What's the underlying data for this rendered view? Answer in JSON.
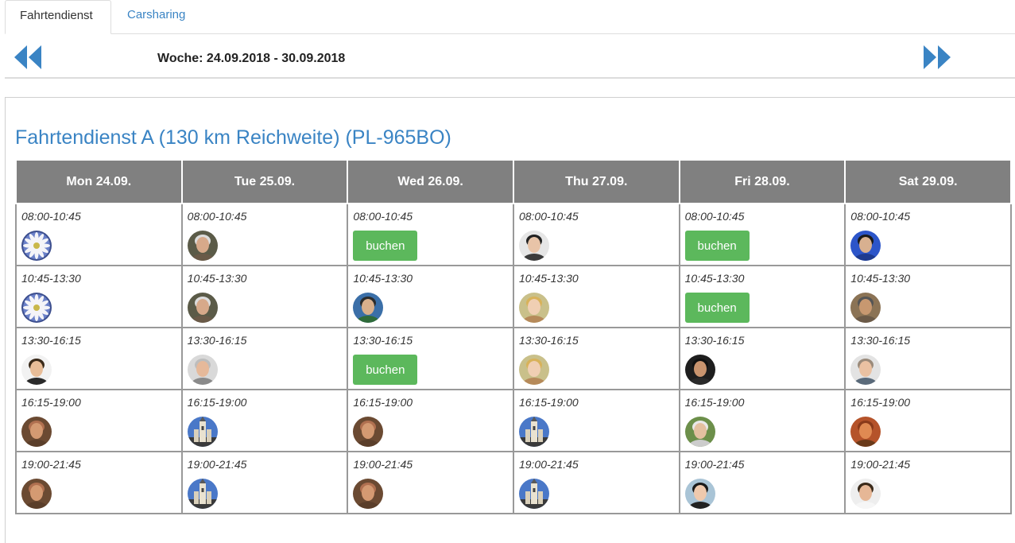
{
  "tabs": [
    {
      "label": "Fahrtendienst",
      "active": true
    },
    {
      "label": "Carsharing",
      "active": false
    }
  ],
  "week": {
    "label": "Woche: 24.09.2018 - 30.09.2018"
  },
  "panel": {
    "title": "Fahrtendienst A (130 km Reichweite) (PL-965BO)"
  },
  "colors": {
    "accent": "#3a84c4",
    "header_bg": "#808080",
    "book_green": "#5cb85c"
  },
  "days": [
    "Mon 24.09.",
    "Tue 25.09.",
    "Wed 26.09.",
    "Thu 27.09.",
    "Fri 28.09.",
    "Sat 29.09."
  ],
  "book_label": "buchen",
  "slots": [
    {
      "time": "08:00-10:45",
      "cells": [
        {
          "type": "avatar",
          "icon": "flower-avatar"
        },
        {
          "type": "avatar",
          "icon": "user-avatar-bearded-man"
        },
        {
          "type": "book"
        },
        {
          "type": "avatar",
          "icon": "user-avatar-woman-dark-hair"
        },
        {
          "type": "book"
        },
        {
          "type": "avatar",
          "icon": "user-avatar-blue-logo"
        }
      ]
    },
    {
      "time": "10:45-13:30",
      "cells": [
        {
          "type": "avatar",
          "icon": "flower-avatar"
        },
        {
          "type": "avatar",
          "icon": "user-avatar-bearded-man"
        },
        {
          "type": "avatar",
          "icon": "user-avatar-outdoor"
        },
        {
          "type": "avatar",
          "icon": "user-avatar-blonde-woman"
        },
        {
          "type": "book"
        },
        {
          "type": "avatar",
          "icon": "user-avatar-sunglasses"
        }
      ]
    },
    {
      "time": "13:30-16:15",
      "cells": [
        {
          "type": "avatar",
          "icon": "user-avatar-young-man"
        },
        {
          "type": "avatar",
          "icon": "user-avatar-grey-man"
        },
        {
          "type": "book"
        },
        {
          "type": "avatar",
          "icon": "user-avatar-blonde-woman"
        },
        {
          "type": "avatar",
          "icon": "user-avatar-dark-man"
        },
        {
          "type": "avatar",
          "icon": "user-avatar-glasses-man"
        }
      ]
    },
    {
      "time": "16:15-19:00",
      "cells": [
        {
          "type": "avatar",
          "icon": "user-avatar-bald-glasses"
        },
        {
          "type": "avatar",
          "icon": "church-avatar"
        },
        {
          "type": "avatar",
          "icon": "user-avatar-bald-glasses"
        },
        {
          "type": "avatar",
          "icon": "church-avatar"
        },
        {
          "type": "avatar",
          "icon": "user-avatar-green-outdoor"
        },
        {
          "type": "avatar",
          "icon": "user-avatar-orange-face"
        }
      ]
    },
    {
      "time": "19:00-21:45",
      "cells": [
        {
          "type": "avatar",
          "icon": "user-avatar-bald-glasses"
        },
        {
          "type": "avatar",
          "icon": "church-avatar"
        },
        {
          "type": "avatar",
          "icon": "user-avatar-bald-glasses"
        },
        {
          "type": "avatar",
          "icon": "church-avatar"
        },
        {
          "type": "avatar",
          "icon": "user-avatar-dark-hair-woman"
        },
        {
          "type": "avatar",
          "icon": "user-avatar-white-shirt-man"
        }
      ]
    }
  ]
}
